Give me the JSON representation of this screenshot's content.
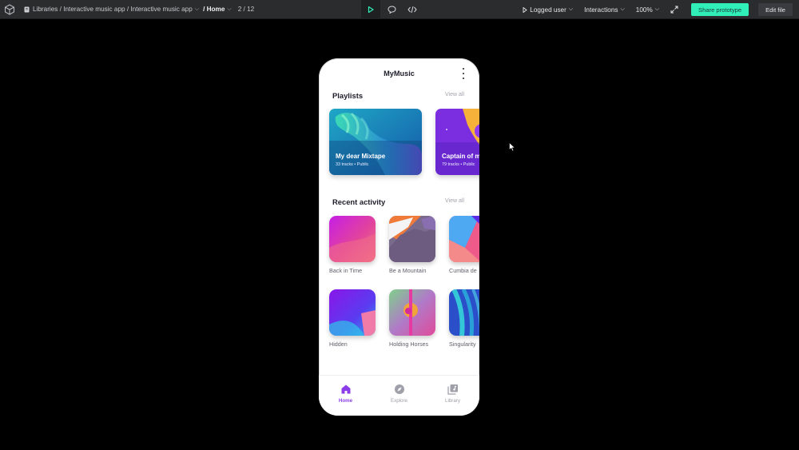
{
  "toolbar": {
    "breadcrumb": "Libraries / Interactive music app / Interactive music app",
    "page": "/ Home",
    "page_count": "2 / 12",
    "user_mode": "Logged user",
    "interactions": "Interactions",
    "zoom": "100%",
    "share_label": "Share prototype",
    "edit_label": "Edit file",
    "share_color": "#31efb8"
  },
  "app": {
    "title": "MyMusic",
    "accent": "#8b3dea",
    "playlists": {
      "title": "Playlists",
      "view_all": "View all",
      "items": [
        {
          "title": "My dear Mixtape",
          "meta": "33 tracks • Public"
        },
        {
          "title": "Captain of m",
          "meta": "79 tracks • Public"
        }
      ]
    },
    "recent": {
      "title": "Recent activity",
      "view_all": "View all",
      "items": [
        {
          "label": "Back in Time"
        },
        {
          "label": "Be a Mountain"
        },
        {
          "label": "Cumbia de"
        },
        {
          "label": "Hidden"
        },
        {
          "label": "Holding Horses"
        },
        {
          "label": "Singularity"
        }
      ]
    },
    "tabs": [
      {
        "label": "Home",
        "icon": "home-icon"
      },
      {
        "label": "Explore",
        "icon": "compass-icon"
      },
      {
        "label": "Library",
        "icon": "library-icon"
      }
    ]
  }
}
